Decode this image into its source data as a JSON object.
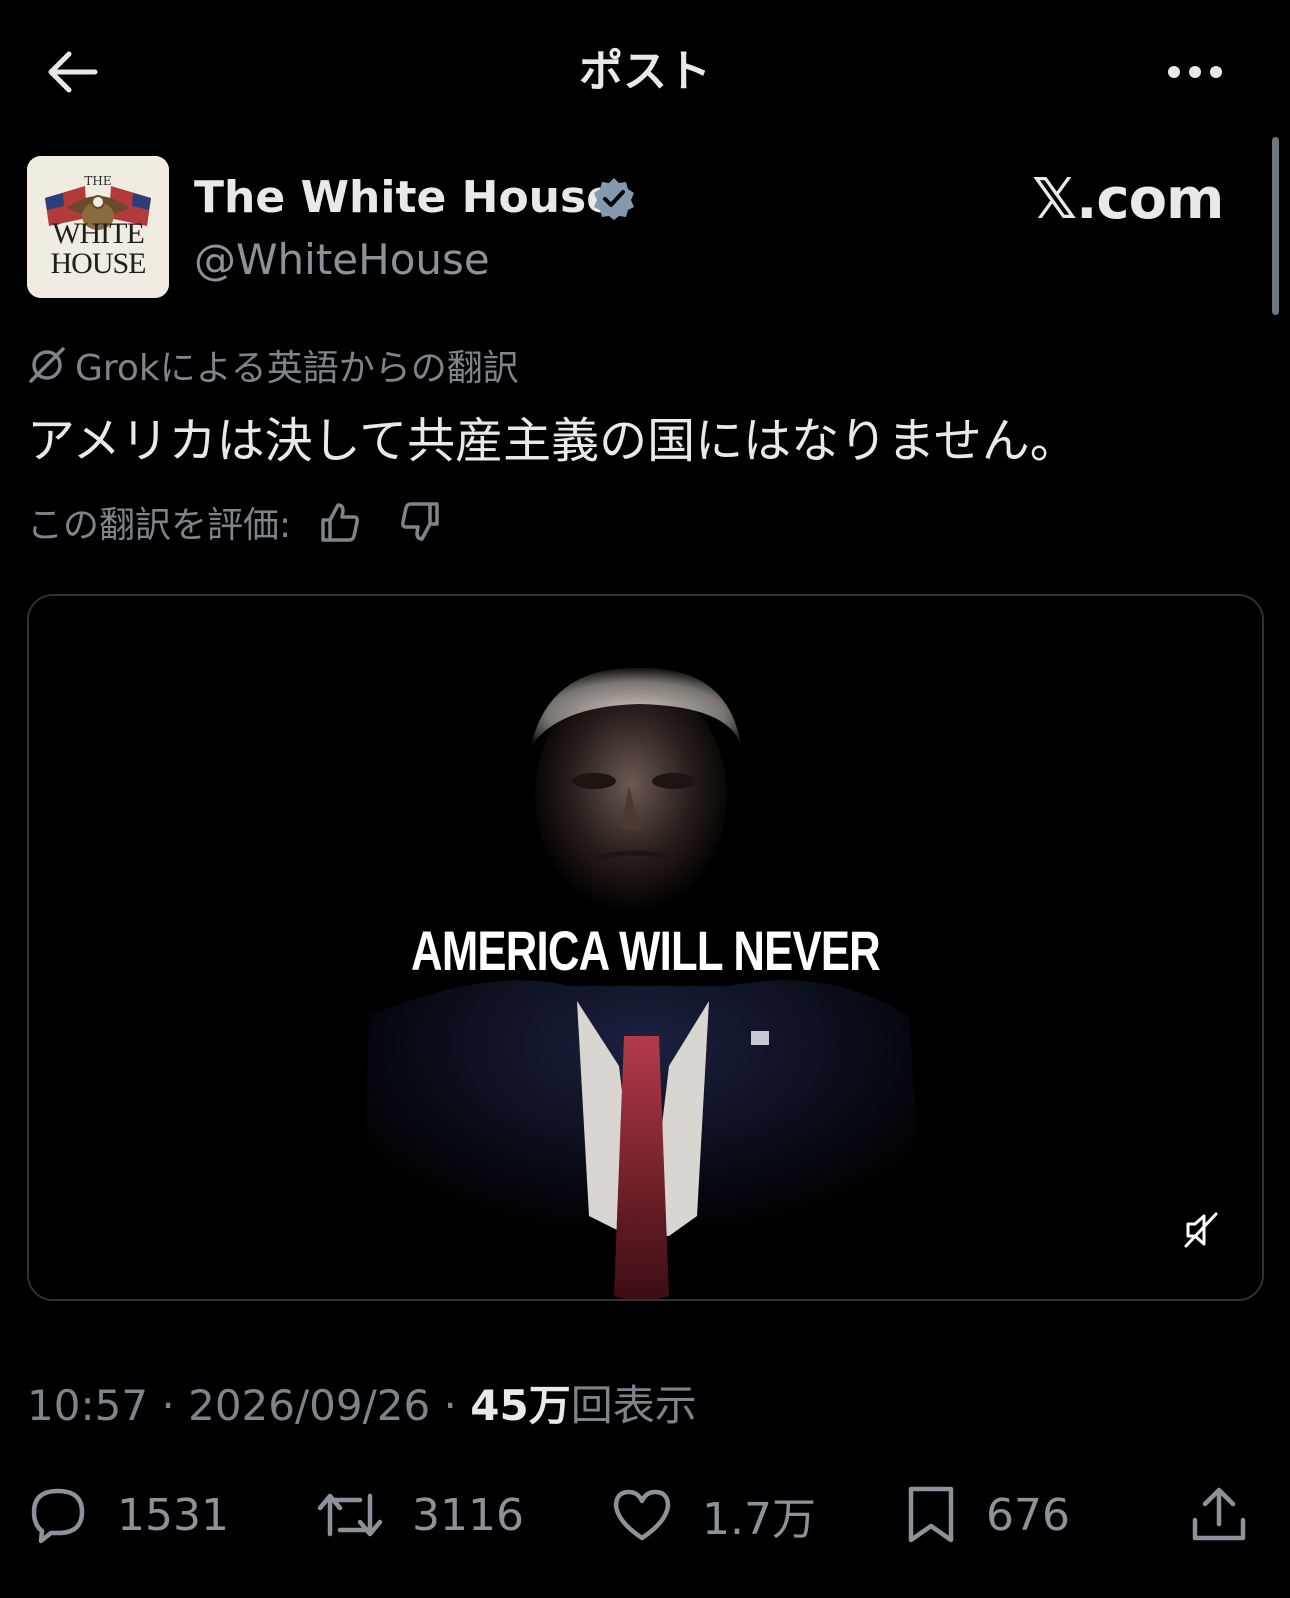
{
  "header": {
    "title": "ポスト"
  },
  "author": {
    "name": "The White House",
    "handle": "@WhiteHouse",
    "avatar_text_top": "THE",
    "avatar_text_mid": "WHITE",
    "avatar_text_bottom": "HOUSE"
  },
  "watermark": "𝕏.com",
  "translation": {
    "source_label": "Grokによる英語からの翻訳",
    "text": "アメリカは決して共産主義の国にはなりません。",
    "rate_label": "この翻訳を評価:"
  },
  "media": {
    "caption": "AMERICA WILL NEVER"
  },
  "meta": {
    "time": "10:57",
    "separator": " · ",
    "date": "2026/09/26",
    "views_count": "45万",
    "views_label": "回表示"
  },
  "actions": {
    "replies": "1531",
    "reposts": "3116",
    "likes": "1.7万",
    "bookmarks": "676"
  },
  "colors": {
    "background": "#000000",
    "text_primary": "#e7e9ea",
    "text_secondary": "#7d848b",
    "verified": "#829aab"
  }
}
